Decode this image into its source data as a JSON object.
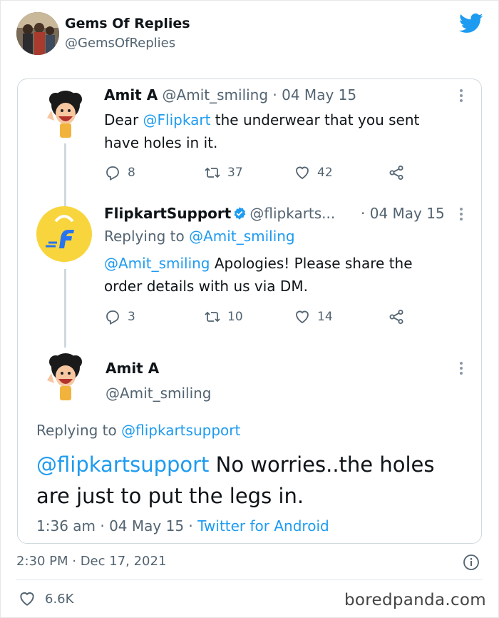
{
  "outer": {
    "name": "Gems Of Replies",
    "handle": "@GemsOfReplies",
    "timestamp": "2:30 PM · Dec 17, 2021",
    "likes": "6.6K"
  },
  "thread": {
    "tweet1": {
      "name": "Amit A",
      "meta": "@Amit_smiling · 04 May 15",
      "text_prefix": "Dear ",
      "text_link": "@Flipkart",
      "text_suffix": " the underwear that you sent have holes in it.",
      "replies": "8",
      "retweets": "37",
      "likes": "42"
    },
    "tweet2": {
      "name": "FlipkartSupport",
      "handle": "@flipkarts...",
      "date": "· 04 May 15",
      "replying_prefix": "Replying to ",
      "replying_link": "@Amit_smiling",
      "text_link": "@Amit_smiling",
      "text_suffix": " Apologies! Please share the order details with us via DM.",
      "replies": "3",
      "retweets": "10",
      "likes": "14"
    },
    "tweet3": {
      "name": "Amit A",
      "handle": "@Amit_smiling",
      "replying_prefix": "Replying to ",
      "replying_link": "@flipkartsupport",
      "text_link": "@flipkartsupport",
      "text_suffix": " No worries..the holes are just to put the legs in.",
      "time": "1:36 am · 04 May 15 · ",
      "source": "Twitter for Android"
    }
  },
  "watermark": "boredpanda.com",
  "colors": {
    "accent": "#1d9bf0",
    "muted": "#536471",
    "flipkart_yellow": "#f8d53d",
    "flipkart_blue": "#2874f0"
  }
}
